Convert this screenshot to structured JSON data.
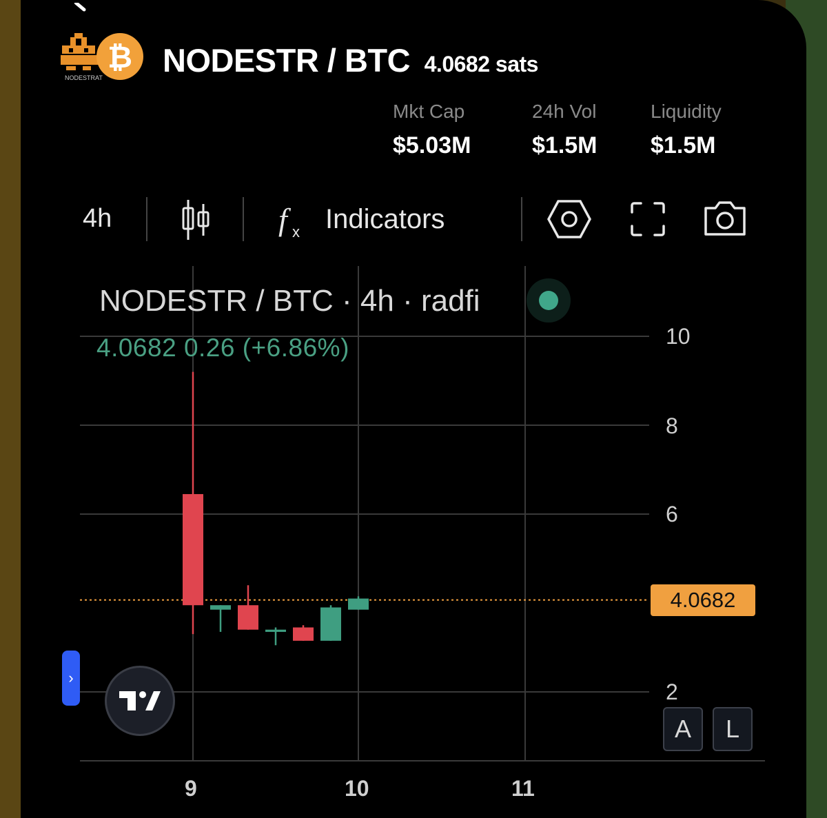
{
  "header": {
    "pair": "NODESTR / BTC",
    "price": "4.0682 sats",
    "logo_text": "NODESTRAT"
  },
  "stats": [
    {
      "label": "Mkt Cap",
      "value": "$5.03M"
    },
    {
      "label": "24h Vol",
      "value": "$1.5M"
    },
    {
      "label": "Liquidity",
      "value": "$1.5M"
    }
  ],
  "toolbar": {
    "interval": "4h",
    "chart_type_icon": "candles-icon",
    "indicators_label": "Indicators",
    "icons": [
      "settings-hex-icon",
      "fullscreen-icon",
      "camera-icon"
    ]
  },
  "legend": {
    "title": "NODESTR / BTC · 4h · radfi",
    "values": "4.0682  0.26 (+6.86%)",
    "status_color": "#40a78a"
  },
  "current_price_tag": "4.0682",
  "side_handle": "›",
  "buttons": {
    "a": "A",
    "l": "L"
  },
  "colors": {
    "up": "#3f9e81",
    "down": "#e0454f",
    "accent": "#f0a040",
    "handle": "#2f5cf5"
  },
  "chart_data": {
    "type": "candlestick",
    "x_tick_labels": [
      "9",
      "10",
      "11"
    ],
    "y_tick_labels": [
      "10",
      "8",
      "6",
      "4.0682",
      "2"
    ],
    "ylim": [
      1.5,
      10.5
    ],
    "last_price": 4.0682,
    "candles": [
      {
        "x": 0,
        "open": 6.45,
        "high": 9.2,
        "low": 3.3,
        "close": 3.95
      },
      {
        "x": 0.5,
        "open": 3.85,
        "high": 3.95,
        "low": 3.35,
        "close": 3.95
      },
      {
        "x": 1,
        "open": 3.95,
        "high": 4.4,
        "low": 3.4,
        "close": 3.4
      },
      {
        "x": 1.5,
        "open": 3.35,
        "high": 3.45,
        "low": 3.05,
        "close": 3.4
      },
      {
        "x": 2,
        "open": 3.45,
        "high": 3.5,
        "low": 3.15,
        "close": 3.15
      },
      {
        "x": 2.5,
        "open": 3.15,
        "high": 3.95,
        "low": 3.15,
        "close": 3.9
      },
      {
        "x": 3,
        "open": 3.85,
        "high": 4.15,
        "low": 3.85,
        "close": 4.1
      }
    ]
  }
}
